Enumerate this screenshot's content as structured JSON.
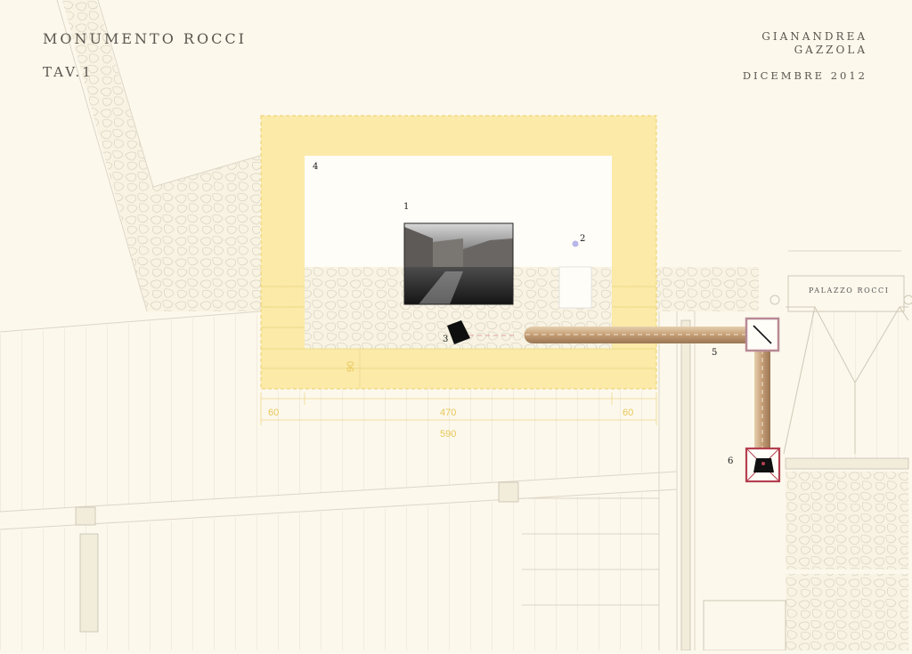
{
  "header": {
    "title": "MONUMENTO ROCCI",
    "subtitle": "TAV.1",
    "author_line1": "GIANANDREA",
    "author_line2": "GAZZOLA",
    "date": "DICEMBRE 2012"
  },
  "labels": {
    "building": "PALAZZO ROCCI",
    "n1": "1",
    "n2": "2",
    "n3": "3",
    "n4": "4",
    "n5": "5",
    "n6": "6"
  },
  "dimensions": {
    "left": "60",
    "center": "470",
    "right": "60",
    "total": "590",
    "vertical": "90"
  },
  "colors": {
    "paper": "#fcf8ec",
    "monument_frame": "#fbe9a4",
    "dimension_text": "#e8c75a",
    "tube": "#c9a27a",
    "box_outline": "#b88a95",
    "photo": "#2a2a2a"
  }
}
